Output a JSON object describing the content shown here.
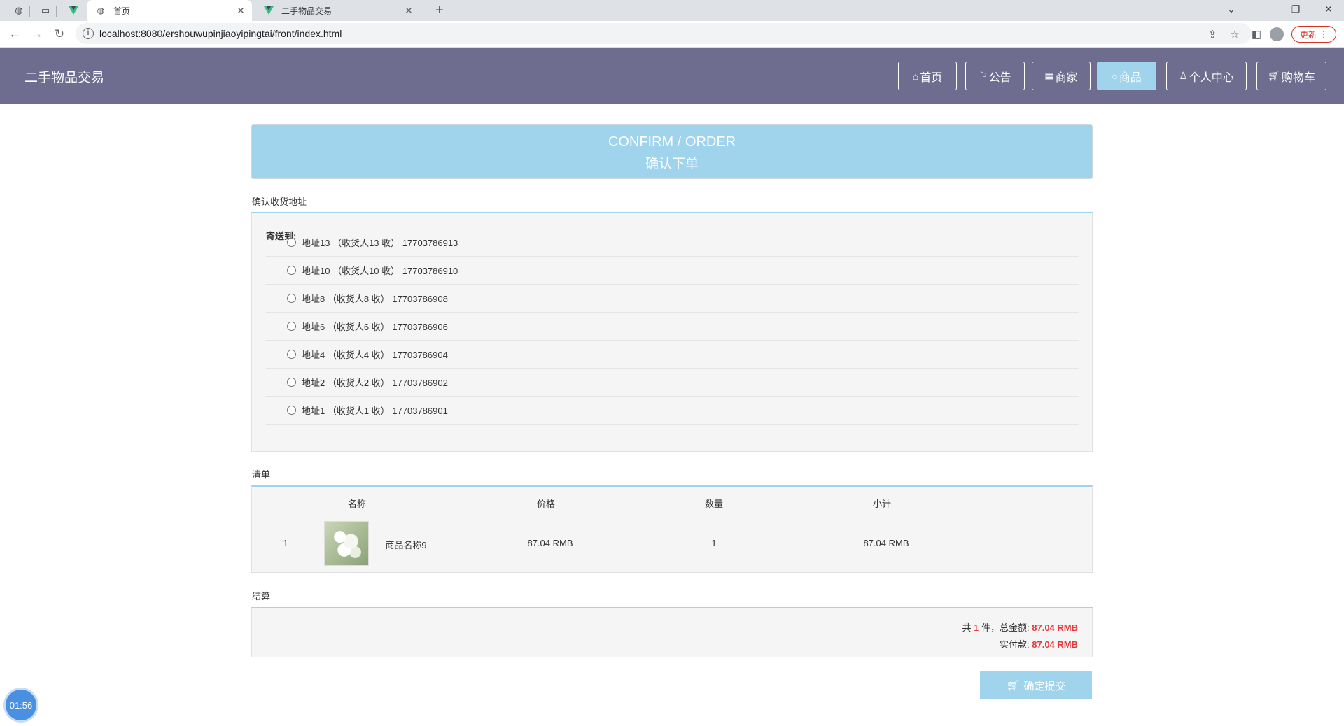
{
  "browser": {
    "tabs": [
      {
        "title": "首页",
        "active": true
      },
      {
        "title": "二手物品交易",
        "active": false
      }
    ],
    "url": "localhost:8080/ershouwupinjiaoyipingtai/front/index.html",
    "update_label": "更新"
  },
  "header": {
    "site_title": "二手物品交易",
    "nav": [
      {
        "label": "首页",
        "icon": "home-icon",
        "active": false
      },
      {
        "label": "公告",
        "icon": "flag-icon",
        "active": false
      },
      {
        "label": "商家",
        "icon": "gift-icon",
        "active": false
      },
      {
        "label": "商品",
        "icon": "circle-icon",
        "active": true
      },
      {
        "label": "个人中心",
        "icon": "user-icon",
        "active": false
      },
      {
        "label": "购物车",
        "icon": "cart-icon",
        "active": false
      }
    ]
  },
  "banner": {
    "en": "CONFIRM / ORDER",
    "zh": "确认下单"
  },
  "address_section": {
    "title": "确认收货地址",
    "send_to": "寄送到:",
    "addresses": [
      "地址13 （收货人13 收） 17703786913",
      "地址10 （收货人10 收） 17703786910",
      "地址8 （收货人8 收） 17703786908",
      "地址6 （收货人6 收） 17703786906",
      "地址4 （收货人4 收） 17703786904",
      "地址2 （收货人2 收） 17703786902",
      "地址1 （收货人1 收） 17703786901"
    ]
  },
  "list_section": {
    "title": "清单",
    "columns": [
      "名称",
      "价格",
      "数量",
      "小计"
    ],
    "rows": [
      {
        "index": "1",
        "name": "商品名称9",
        "price": "87.04 RMB",
        "quantity": "1",
        "subtotal": "87.04 RMB"
      }
    ]
  },
  "settle_section": {
    "title": "结算",
    "count_prefix": "共",
    "count": "1",
    "count_suffix": "件，总金额:",
    "total": "87.04 RMB",
    "paid_label": "实付款:",
    "paid": "87.04 RMB"
  },
  "submit_label": "确定提交",
  "timer": "01:56",
  "colors": {
    "header_bg": "#6f6d8f",
    "accent": "#9fd4ec",
    "price_red": "#e4393c"
  }
}
